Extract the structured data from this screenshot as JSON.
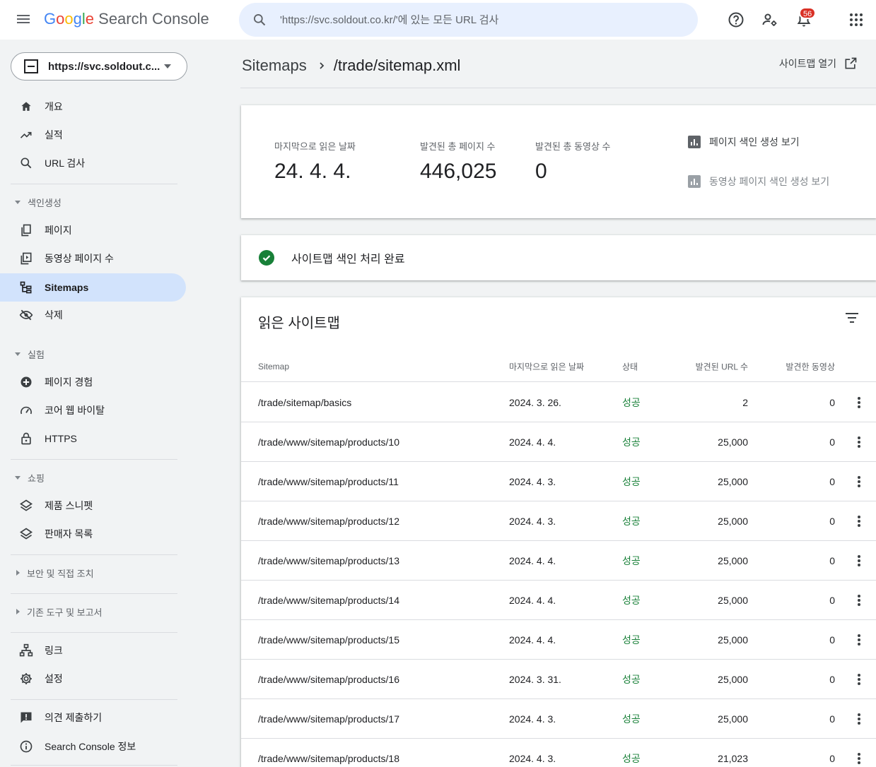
{
  "header": {
    "logo_google": [
      "G",
      "o",
      "o",
      "g",
      "l",
      "e"
    ],
    "logo_product": "Search Console",
    "search_placeholder": "'https://svc.soldout.co.kr/'에 있는 모든 URL 검사",
    "notification_count": "56",
    "icons": [
      "menu-icon",
      "search-icon",
      "help-icon",
      "manage-users-icon",
      "notifications-icon",
      "apps-icon"
    ]
  },
  "sidebar": {
    "property": "https://svc.soldout.c...",
    "items": [
      {
        "label": "개요",
        "icon": "home-icon"
      },
      {
        "label": "실적",
        "icon": "trending-up-icon"
      },
      {
        "label": "URL 검사",
        "icon": "search-icon"
      },
      {
        "label": "페이지",
        "icon": "pages-icon"
      },
      {
        "label": "동영상 페이지 수",
        "icon": "video-pages-icon"
      },
      {
        "label": "Sitemaps",
        "icon": "sitemap-icon",
        "active": true
      },
      {
        "label": "삭제",
        "icon": "removals-icon"
      },
      {
        "label": "페이지 경험",
        "icon": "page-experience-icon"
      },
      {
        "label": "코어 웹 바이탈",
        "icon": "speed-icon"
      },
      {
        "label": "HTTPS",
        "icon": "lock-icon"
      },
      {
        "label": "제품 스니펫",
        "icon": "layers-icon"
      },
      {
        "label": "판매자 목록",
        "icon": "layers-icon"
      },
      {
        "label": "링크",
        "icon": "links-icon"
      },
      {
        "label": "설정",
        "icon": "gear-icon"
      },
      {
        "label": "의견 제출하기",
        "icon": "feedback-icon"
      },
      {
        "label": "Search Console 정보",
        "icon": "info-icon"
      }
    ],
    "sections": [
      {
        "label": "색인생성",
        "expanded": true
      },
      {
        "label": "실험",
        "expanded": true
      },
      {
        "label": "쇼핑",
        "expanded": true
      },
      {
        "label": "보안 및 직접 조치",
        "expanded": false
      },
      {
        "label": "기존 도구 및 보고서",
        "expanded": false
      }
    ]
  },
  "breadcrumb": {
    "parent": "Sitemaps",
    "current": "/trade/sitemap.xml",
    "open_link": "사이트맵 열기"
  },
  "summary": {
    "last_read_label": "마지막으로 읽은 날짜",
    "last_read_value": "24. 4. 4.",
    "pages_label": "발견된 총 페이지 수",
    "pages_value": "446,025",
    "videos_label": "발견된 총 동영상 수",
    "videos_value": "0",
    "link_page_index": "페이지 색인 생성 보기",
    "link_video_index": "동영상 페이지 색인 생성 보기"
  },
  "status": {
    "text": "사이트맵 색인 처리 완료",
    "color": "#188038"
  },
  "table": {
    "title": "읽은 사이트맵",
    "columns": [
      "Sitemap",
      "마지막으로 읽은 날짜",
      "상태",
      "발견된 URL 수",
      "발견한 동영상"
    ],
    "rows": [
      [
        "/trade/sitemap/basics",
        "2024. 3. 26.",
        "성공",
        "2",
        "0"
      ],
      [
        "/trade/www/sitemap/products/10",
        "2024. 4. 4.",
        "성공",
        "25,000",
        "0"
      ],
      [
        "/trade/www/sitemap/products/11",
        "2024. 4. 3.",
        "성공",
        "25,000",
        "0"
      ],
      [
        "/trade/www/sitemap/products/12",
        "2024. 4. 3.",
        "성공",
        "25,000",
        "0"
      ],
      [
        "/trade/www/sitemap/products/13",
        "2024. 4. 4.",
        "성공",
        "25,000",
        "0"
      ],
      [
        "/trade/www/sitemap/products/14",
        "2024. 4. 4.",
        "성공",
        "25,000",
        "0"
      ],
      [
        "/trade/www/sitemap/products/15",
        "2024. 4. 4.",
        "성공",
        "25,000",
        "0"
      ],
      [
        "/trade/www/sitemap/products/16",
        "2024. 3. 31.",
        "성공",
        "25,000",
        "0"
      ],
      [
        "/trade/www/sitemap/products/17",
        "2024. 4. 3.",
        "성공",
        "25,000",
        "0"
      ],
      [
        "/trade/www/sitemap/products/18",
        "2024. 4. 3.",
        "성공",
        "21,023",
        "0"
      ]
    ]
  },
  "colors": {
    "accent": "#1a73e8",
    "active_nav": "#d2e3fc",
    "success": "#188038",
    "badge": "#d93025"
  }
}
